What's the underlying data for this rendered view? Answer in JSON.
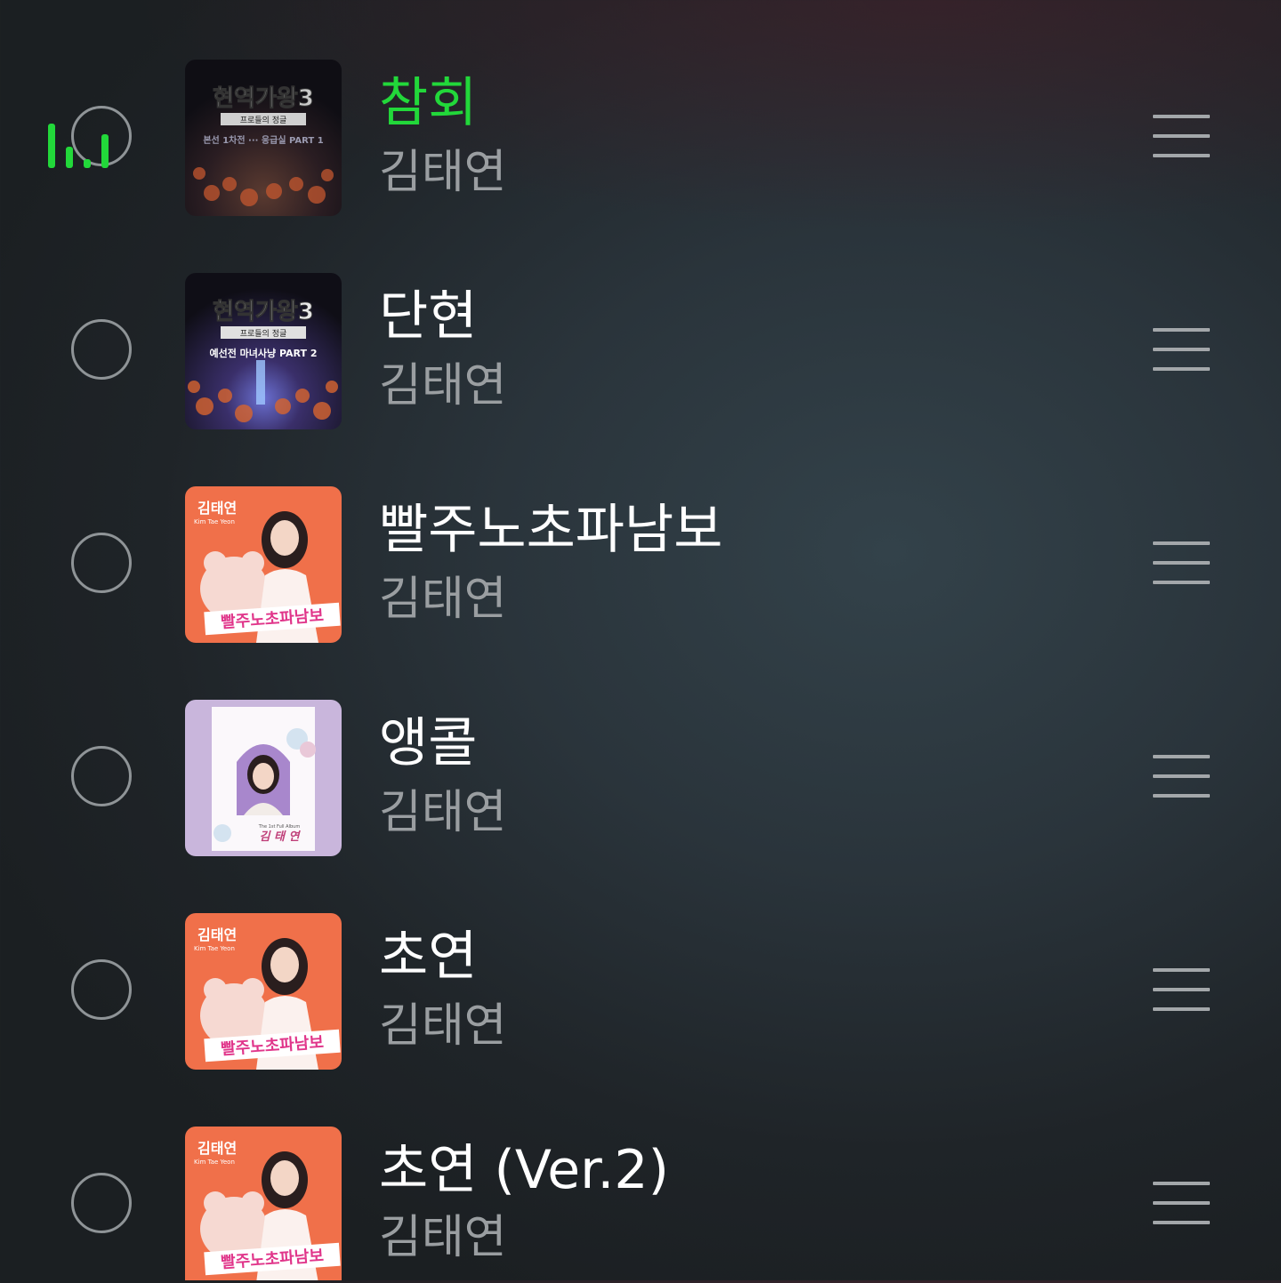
{
  "playlist": {
    "items": [
      {
        "title": "참회",
        "artist": "김태연",
        "playing": true,
        "cover": {
          "style": "stage",
          "lines": [
            "현역가왕3",
            "프로들의 정글",
            "본선 1차전 ··· 응급실 PART 1"
          ]
        }
      },
      {
        "title": "단현",
        "artist": "김태연",
        "playing": false,
        "cover": {
          "style": "stage",
          "lines": [
            "현역가왕3",
            "프로들의 정글",
            "예선전 마녀사냥 PART 2"
          ]
        }
      },
      {
        "title": "빨주노초파남보",
        "artist": "김태연",
        "playing": false,
        "cover": {
          "style": "orange",
          "lines": [
            "김태연",
            "Kim Tae Yeon",
            "빨주노초파남보"
          ]
        }
      },
      {
        "title": "앵콜",
        "artist": "김태연",
        "playing": false,
        "cover": {
          "style": "lavender",
          "lines": [
            "The 1st Full Album",
            "김 태 연"
          ]
        }
      },
      {
        "title": "초연",
        "artist": "김태연",
        "playing": false,
        "cover": {
          "style": "orange",
          "lines": [
            "김태연",
            "Kim Tae Yeon",
            "빨주노초파남보"
          ]
        }
      },
      {
        "title": "초연 (Ver.2)",
        "artist": "김태연",
        "playing": false,
        "cover": {
          "style": "orange",
          "lines": [
            "김태연",
            "Kim Tae Yeon",
            "빨주노초파남보"
          ]
        }
      }
    ]
  },
  "colors": {
    "playing_title": "#22d83a",
    "title": "#ffffff",
    "artist": "#9a9ea1",
    "circle": "#8f9497",
    "handle": "#a3a7aa"
  },
  "icons": {
    "select": "circle-outline-icon",
    "drag": "drag-handle-icon",
    "playing": "equalizer-icon"
  }
}
